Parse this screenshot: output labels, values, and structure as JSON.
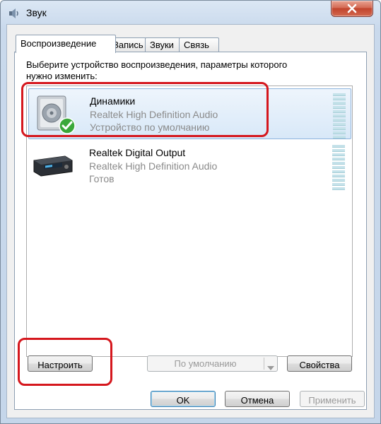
{
  "window": {
    "title": "Звук"
  },
  "tabs": [
    {
      "label": "Воспроизведение",
      "active": true
    },
    {
      "label": "Запись",
      "active": false
    },
    {
      "label": "Звуки",
      "active": false
    },
    {
      "label": "Связь",
      "active": false
    }
  ],
  "instruction": {
    "line1": "Выберите устройство воспроизведения, параметры которого",
    "line2": "нужно изменить:"
  },
  "devices": [
    {
      "name": "Динамики",
      "driver": "Realtek High Definition Audio",
      "status": "Устройство по умолчанию",
      "icon": "speaker-icon",
      "default_badge": "green-checkmark-icon",
      "selected": true
    },
    {
      "name": "Realtek Digital Output",
      "driver": "Realtek High Definition Audio",
      "status": "Готов",
      "icon": "digital-output-receiver-icon",
      "selected": false
    }
  ],
  "buttons": {
    "configure": "Настроить",
    "set_default": "По умолчанию",
    "properties": "Свойства",
    "ok": "OK",
    "cancel": "Отмена",
    "apply": "Применить"
  },
  "colors": {
    "annotation": "#d5171d",
    "selection": "#d8e8f8",
    "close_button": "#c2442d"
  }
}
